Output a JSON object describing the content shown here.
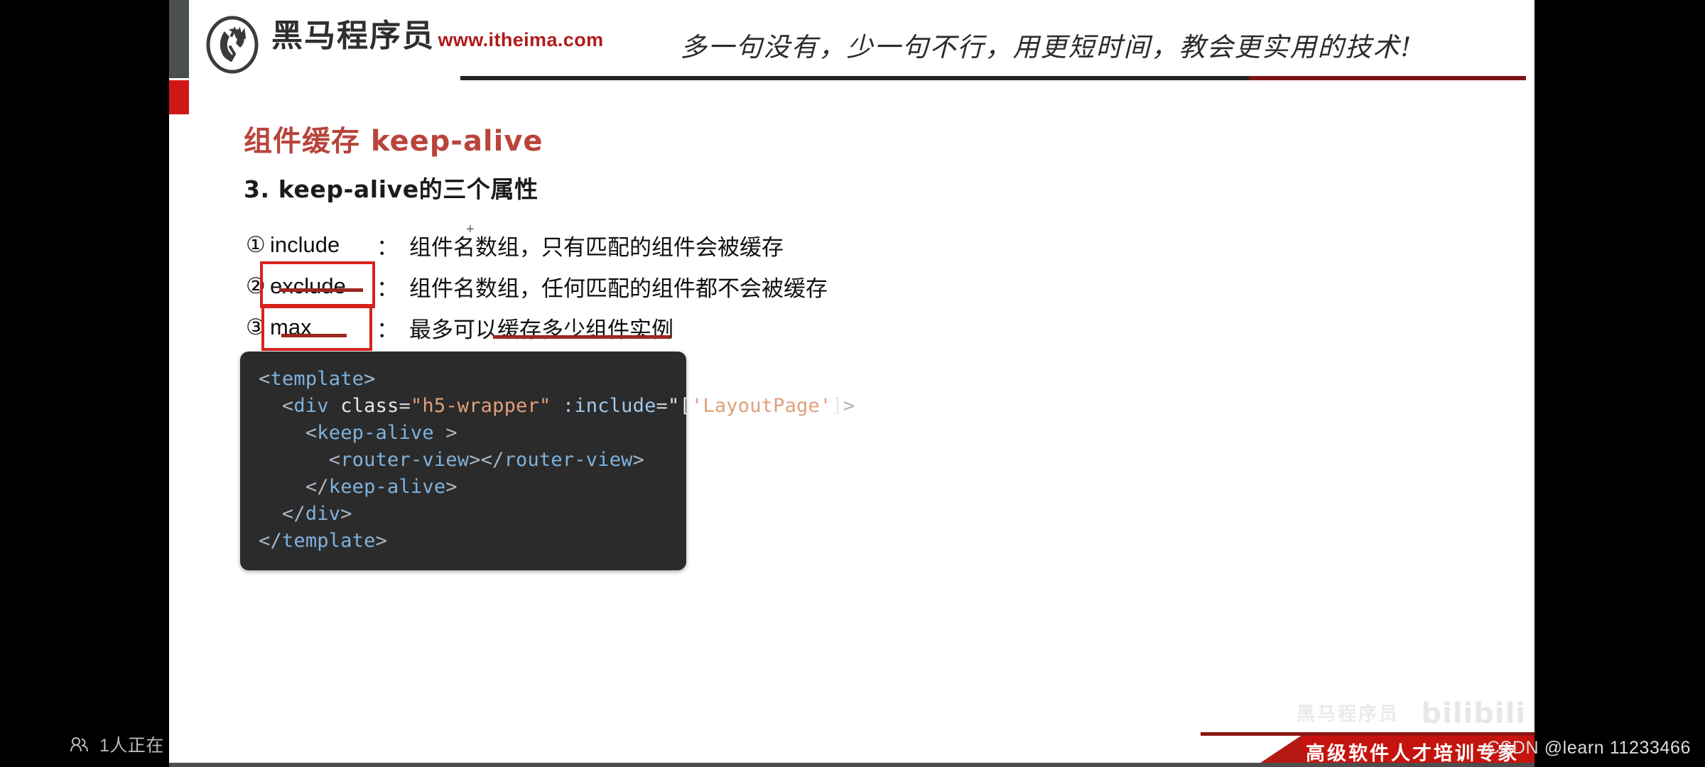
{
  "player": {
    "viewer_count_text": "1人正在",
    "viewers_icon": "people-icon",
    "csdn_watermark": "CSDN @learn 11233466",
    "bili_watermark": "bilibili",
    "bili_sub_watermark": "黑马程序员",
    "bottom_banner_text": "高级软件人才培训专家"
  },
  "slide": {
    "brand": {
      "logo_icon": "horse-head-logo",
      "name_cn": "黑马程序员",
      "url": "www.itheima.com"
    },
    "tagline": "多一句没有，少一句不行，用更短时间，教会更实用的技术!",
    "title": "组件缓存 keep-alive",
    "section_title": "3. keep-alive的三个属性",
    "bullets": [
      {
        "num": "①",
        "key": "include",
        "colon": "：",
        "desc": "组件名数组，只有匹配的组件会被缓存",
        "highlighted": false
      },
      {
        "num": "②",
        "key": "exclude",
        "colon": "：",
        "desc": "组件名数组，任何匹配的组件都不会被缓存",
        "highlighted": true
      },
      {
        "num": "③",
        "key": "max",
        "colon": "：",
        "desc": "最多可以缓存多少组件实例",
        "highlighted": true
      }
    ],
    "annotation_color": "#d6231d",
    "underline_color": "#9e2720",
    "cursor_mark": "+",
    "code": {
      "language": "vue-html",
      "lines": [
        [
          {
            "t": "<",
            "c": "punct"
          },
          {
            "t": "template",
            "c": "tag"
          },
          {
            "t": ">",
            "c": "punct"
          }
        ],
        [
          {
            "t": "  <",
            "c": "punct"
          },
          {
            "t": "div",
            "c": "tag"
          },
          {
            "t": " class",
            "c": "attr"
          },
          {
            "t": "=",
            "c": "eq"
          },
          {
            "t": "\"h5-wrapper\"",
            "c": "str"
          },
          {
            "t": " :include",
            "c": "bind"
          },
          {
            "t": "=",
            "c": "eq"
          },
          {
            "t": "\"[",
            "c": "attr"
          },
          {
            "t": "'LayoutPage'",
            "c": "str"
          },
          {
            "t": "]",
            "c": "attr"
          },
          {
            "t": ">",
            "c": "punct"
          }
        ],
        [
          {
            "t": "    <",
            "c": "punct"
          },
          {
            "t": "keep-alive",
            "c": "tag"
          },
          {
            "t": " >",
            "c": "punct"
          }
        ],
        [
          {
            "t": "      <",
            "c": "punct"
          },
          {
            "t": "router-view",
            "c": "tag"
          },
          {
            "t": "></",
            "c": "punct"
          },
          {
            "t": "router-view",
            "c": "tag"
          },
          {
            "t": ">",
            "c": "punct"
          }
        ],
        [
          {
            "t": "    </",
            "c": "punct"
          },
          {
            "t": "keep-alive",
            "c": "tag"
          },
          {
            "t": ">",
            "c": "punct"
          }
        ],
        [
          {
            "t": "  </",
            "c": "punct"
          },
          {
            "t": "div",
            "c": "tag"
          },
          {
            "t": ">",
            "c": "punct"
          }
        ],
        [
          {
            "t": "</",
            "c": "punct"
          },
          {
            "t": "template",
            "c": "tag"
          },
          {
            "t": ">",
            "c": "punct"
          }
        ]
      ]
    }
  }
}
